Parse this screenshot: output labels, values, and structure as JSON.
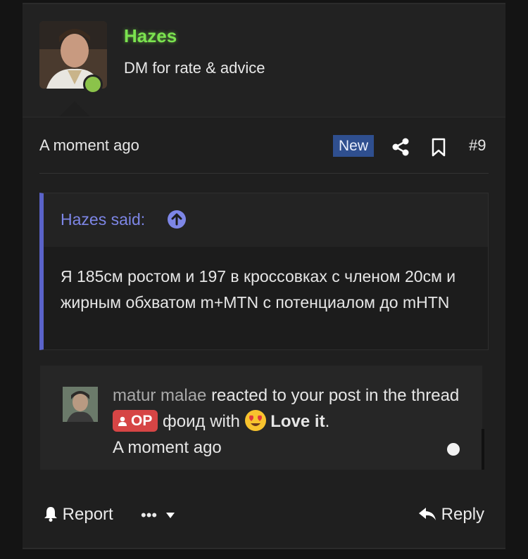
{
  "post": {
    "username": "Hazes",
    "user_title": "DM for rate & advice",
    "time": "A moment ago",
    "badge": "New",
    "number": "#9",
    "colors": {
      "username": "#7be34f",
      "online": "#8bc34a",
      "new_badge": "#2f4f8f",
      "quote_accent": "#5a63c9"
    }
  },
  "quote": {
    "attribution": "Hazes said:",
    "text": "Я 185см ростом и 197 в кроссовках с членом 20см и жирным обхватом m+MTN с потенциалом до mHTN"
  },
  "notification": {
    "user": "matur malae",
    "text_before": "reacted to your post in the thread",
    "op_label": "OP",
    "thread": "фоид",
    "with_text": "with",
    "reaction": "Love it",
    "end": ".",
    "time": "A moment ago"
  },
  "actions": {
    "report": "Report",
    "more": "•••",
    "reply": "Reply"
  },
  "icons": [
    "share-icon",
    "bookmark-icon",
    "bell-icon",
    "reply-icon",
    "chevron-down-icon",
    "arrow-up-circle-icon",
    "user-icon",
    "heart-eyes-emoji"
  ]
}
